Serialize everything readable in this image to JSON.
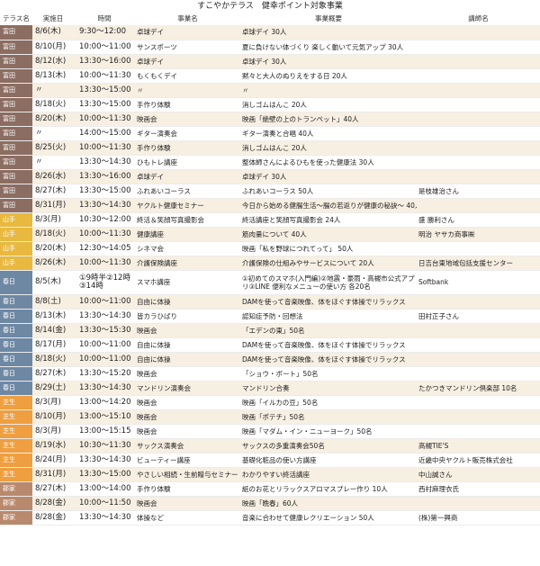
{
  "title": "すこやかテラス　健幸ポイント対象事業",
  "headers": [
    "テラス名",
    "実施日",
    "時間",
    "事業名",
    "事業概要",
    "講師名"
  ],
  "terrace_colors": {
    "富田": "#8b6d62",
    "山手": "#e8b93e",
    "春日": "#6e88a4",
    "芝生": "#ef9e40",
    "郡家": "#b9896d"
  },
  "rows": [
    [
      "富田",
      "8/6(木)",
      "9:30～12:00",
      "卓球デイ",
      "卓球デイ 30人",
      ""
    ],
    [
      "富田",
      "8/10(月)",
      "10:00～11:00",
      "サンスポーツ",
      "夏に負けない体づくり 楽しく動いて元気アップ 30人",
      ""
    ],
    [
      "富田",
      "8/12(水)",
      "13:30～16:00",
      "卓球デイ",
      "卓球デイ 30人",
      ""
    ],
    [
      "富田",
      "8/13(木)",
      "10:00～11:30",
      "もくもくデイ",
      "黙々と大人のぬりえをする日 20人",
      ""
    ],
    [
      "富田",
      "〃",
      "13:30～15:00",
      "〃",
      "〃",
      ""
    ],
    [
      "富田",
      "8/18(火)",
      "13:30～15:00",
      "手作り体験",
      "消しゴムはんこ 20人",
      ""
    ],
    [
      "富田",
      "8/20(木)",
      "10:00～11:30",
      "映画会",
      "映画「絶壁の上のトランペット」40人",
      ""
    ],
    [
      "富田",
      "〃",
      "14:00～15:00",
      "ギター演奏会",
      "ギター演奏と合唱 40人",
      ""
    ],
    [
      "富田",
      "8/25(火)",
      "10:00～11:30",
      "手作り体験",
      "消しゴムはんこ 20人",
      ""
    ],
    [
      "富田",
      "〃",
      "13:30～14:30",
      "ひもトレ講座",
      "整体師さんによるひもを使った健康法 30人",
      ""
    ],
    [
      "富田",
      "8/26(水)",
      "13:30～16:00",
      "卓球デイ",
      "卓球デイ 30人",
      ""
    ],
    [
      "富田",
      "8/27(木)",
      "13:30～15:00",
      "ふれあいコーラス",
      "ふれあいコーラス 50人",
      "是枝雄治さん"
    ],
    [
      "富田",
      "8/31(月)",
      "13:30～14:30",
      "ヤクルト健康セミナー",
      "今日から始める健腸生活～腸の若返りが健康の秘訣～ 40人",
      ""
    ],
    [
      "山手",
      "8/3(月)",
      "10:30～12:00",
      "終活＆笑顔写真撮影会",
      "終活講座と笑顔写真撮影会 24人",
      "盛 勝利さん"
    ],
    [
      "山手",
      "8/18(火)",
      "10:00～11:30",
      "健康講座",
      "筋肉量について 40人",
      "明治 ヤサカ商事㈱"
    ],
    [
      "山手",
      "8/20(木)",
      "12:30～14:05",
      "シネマ会",
      "映画「私を野球につれてって」 50人",
      ""
    ],
    [
      "山手",
      "8/26(木)",
      "10:00～11:30",
      "介護保険講座",
      "介護保険の仕組みやサービスについて 20人",
      "日吉台東地域包括支援センター"
    ],
    [
      "春日",
      "8/5(木)",
      "①9時半②12時\n③14時",
      "スマホ講座",
      "①初めてのスマホ(入門編)②地震・豪雨・高槻市公式アプリ③LINE 便利なメニューの使い方 各20名",
      "Softbank"
    ],
    [
      "春日",
      "8/8(土)",
      "10:00～11:00",
      "自由に体操",
      "DAMを使って音楽映像、体をほぐす体操でリラックス",
      ""
    ],
    [
      "春日",
      "8/13(木)",
      "13:30～14:30",
      "皆カラひばり",
      "認知症予防・回想法",
      "田村正子さん"
    ],
    [
      "春日",
      "8/14(金)",
      "13:30～15:30",
      "映画会",
      "「エデンの東」50名",
      ""
    ],
    [
      "春日",
      "8/17(月)",
      "10:00～11:00",
      "自由に体操",
      "DAMを使って音楽映像、体をほぐす体操でリラックス",
      ""
    ],
    [
      "春日",
      "8/18(火)",
      "10:00～11:00",
      "自由に体操",
      "DAMを使って音楽映像、体をほぐす体操でリラックス",
      ""
    ],
    [
      "春日",
      "8/27(木)",
      "13:30～15:20",
      "映画会",
      "「ショウ・ボート」50名",
      ""
    ],
    [
      "春日",
      "8/29(土)",
      "13:30～14:30",
      "マンドリン演奏会",
      "マンドリン合奏",
      "たかつきマンドリン倶楽部 10名"
    ],
    [
      "芝生",
      "8/3(月)",
      "13:00～14:20",
      "映画会",
      "映画「イルカの豆」50名",
      ""
    ],
    [
      "芝生",
      "8/10(月)",
      "13:00～15:10",
      "映画会",
      "映画「ポテチ」50名",
      ""
    ],
    [
      "芝生",
      "8/3(月)",
      "13:00～15:15",
      "映画会",
      "映画「マダム・イン・ニューヨーク」50名",
      ""
    ],
    [
      "芝生",
      "8/19(水)",
      "10:30～11:30",
      "サックス演奏会",
      "サックスの多重演奏会50名",
      "高槻TIE'S"
    ],
    [
      "芝生",
      "8/24(月)",
      "13:30～14:30",
      "ビューティー講座",
      "基礎化粧品の使い方講座",
      "近畿中央ヤクルト販売株式会社"
    ],
    [
      "芝生",
      "8/31(月)",
      "13:30～15:00",
      "やさしい相続・生前贈与セミナー",
      "わかりやすい終活講座",
      "中山誠さん"
    ],
    [
      "郡家",
      "8/27(木)",
      "13:00～14:00",
      "手作り体験",
      "紙のお花とリラックスアロマスプレー作り 10人",
      "西村麻理衣氏"
    ],
    [
      "郡家",
      "8/28(金)",
      "10:00～11:50",
      "映画会",
      "映画「晩春」60人",
      ""
    ],
    [
      "郡家",
      "8/28(金)",
      "13:30～14:30",
      "体操など",
      "音楽に合わせて健康レクリエーション 50人",
      "(株)第一興商"
    ]
  ]
}
